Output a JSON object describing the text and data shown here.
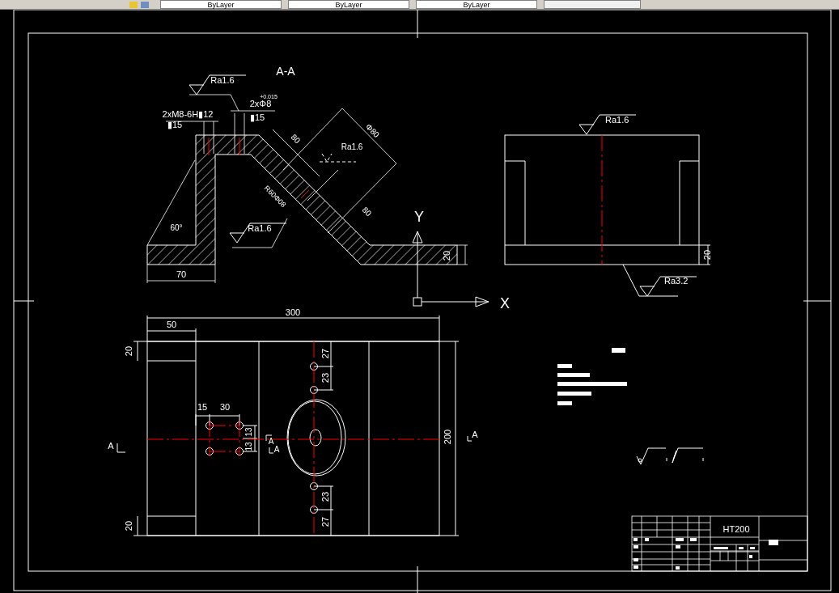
{
  "toolbar": {
    "dropdowns": [
      {
        "label": "ByLayer"
      },
      {
        "label": "ByLayer"
      },
      {
        "label": "ByLayer"
      }
    ]
  },
  "section_view": {
    "title": "A-A",
    "labels": [
      "Ra1.6",
      "2xM8-6H▮12",
      "▮15",
      "2xΦ8",
      "+0.015",
      "▮15",
      "80",
      "Φ80",
      "Ra1.6",
      "R60Φ08",
      "80",
      "60°",
      "Ra1.6",
      "70",
      "20"
    ]
  },
  "side_view": {
    "labels": [
      "Ra1.6",
      "Ra3.2",
      "20"
    ]
  },
  "axes": {
    "y_label": "Y",
    "x_label": "X"
  },
  "plan_view": {
    "labels": [
      "300",
      "50",
      "20",
      "20",
      "15",
      "30",
      "13",
      "13",
      "27",
      "23",
      "23",
      "27",
      "200",
      "A",
      "A",
      "A",
      "A"
    ]
  },
  "title_block": {
    "material": "HT200"
  }
}
